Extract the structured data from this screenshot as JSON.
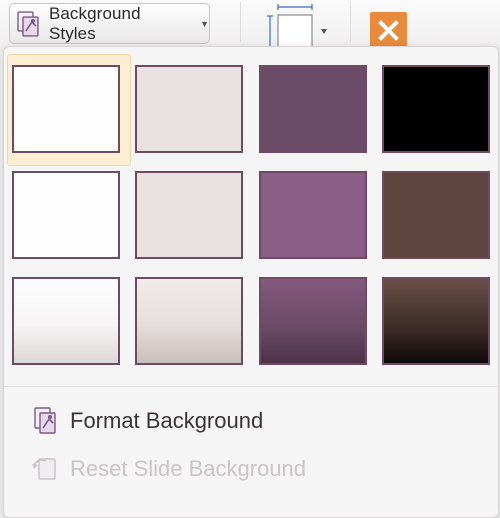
{
  "toolbar": {
    "background_styles_label": "Background Styles"
  },
  "styles_gallery": {
    "selected_index": 0,
    "rows": [
      [
        "#fefefe",
        "#e9e2e1",
        "#6c4b68",
        "#000000"
      ],
      [
        "#fefefe",
        "#e9e2e1",
        "#8a5e87",
        "#5e443d"
      ],
      [
        "linear-gradient(#fdfdfd, #f6f4f4 55%, #dcd8d7)",
        "linear-gradient(#f0ebea, #e6dedc 55%, #c9bfbc)",
        "linear-gradient(#84597f, #6a4a66 60%, #4c3149)",
        "linear-gradient(#6a5048, #3c2a26 60%, #0e0a09)"
      ]
    ]
  },
  "menu": {
    "format_background_label": "Format Background",
    "reset_slide_background_label": "Reset Slide Background"
  },
  "colors": {
    "accent_close": "#e88b3c",
    "swatch_border": "#6f4b62"
  }
}
